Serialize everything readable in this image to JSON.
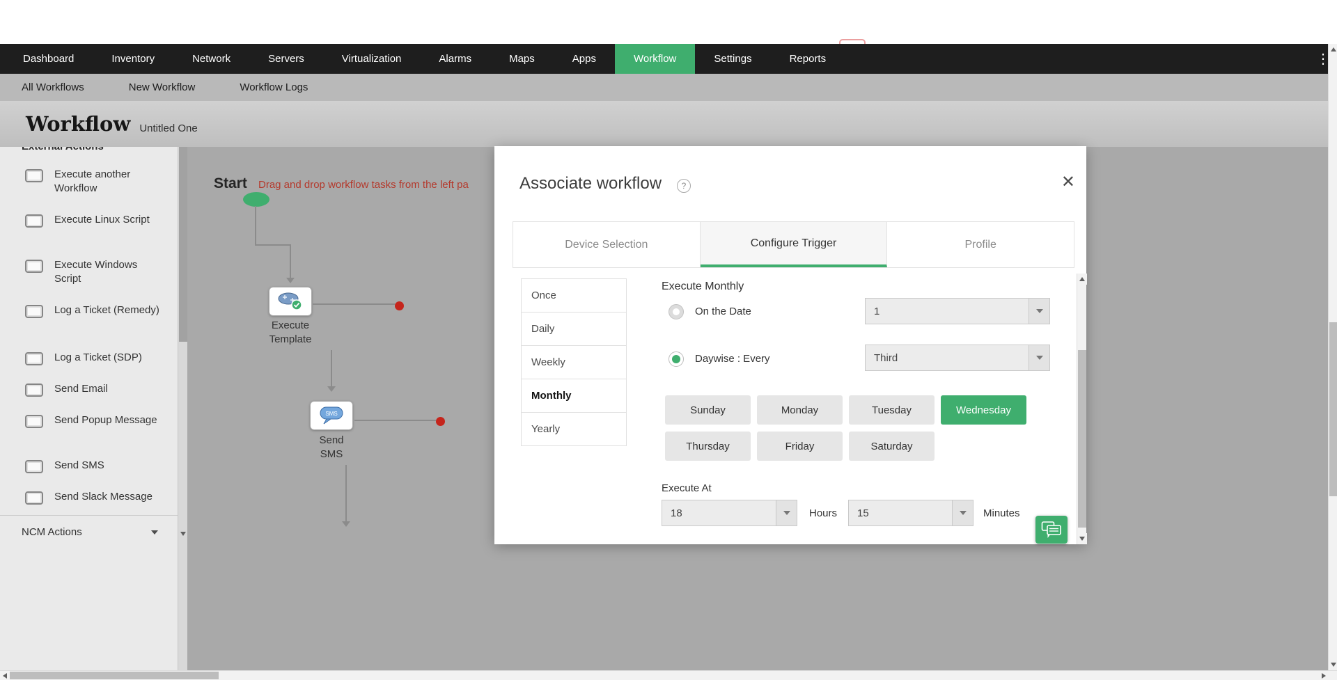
{
  "icons": {
    "kebab": "⋮",
    "help": "?",
    "close": "✕"
  },
  "nav": {
    "items": [
      "Dashboard",
      "Inventory",
      "Network",
      "Servers",
      "Virtualization",
      "Alarms",
      "Maps",
      "Apps",
      "Workflow",
      "Settings",
      "Reports"
    ],
    "active_item": "Workflow"
  },
  "subnav": {
    "items": [
      "All Workflows",
      "New Workflow",
      "Workflow Logs"
    ]
  },
  "page": {
    "title": "Workflow",
    "subtitle": "Untitled One"
  },
  "sidebar": {
    "section_header": "External Actions",
    "items": [
      "Execute another Workflow",
      "Execute Linux Script",
      "Execute Windows Script",
      "Log a Ticket (Remedy)",
      "Log a Ticket (SDP)",
      "Send Email",
      "Send Popup Message",
      "Send SMS",
      "Send Slack Message"
    ],
    "footer": "NCM Actions"
  },
  "canvas": {
    "start_label": "Start",
    "hint": "Drag and drop workflow tasks from the left pa",
    "nodes": [
      {
        "line1": "Execute",
        "line2": "Template"
      },
      {
        "line1": "Send",
        "line2": "SMS",
        "icon_text": "SMS"
      }
    ]
  },
  "modal": {
    "title": "Associate workflow",
    "tabs": [
      "Device Selection",
      "Configure Trigger",
      "Profile"
    ],
    "active_tab": "Configure Trigger",
    "schedule_tabs": [
      "Once",
      "Daily",
      "Weekly",
      "Monthly",
      "Yearly"
    ],
    "active_schedule": "Monthly",
    "heading": "Execute Monthly",
    "on_date": {
      "label": "On the Date",
      "value": "1",
      "selected": false
    },
    "daywise": {
      "label": "Daywise : Every",
      "value": "Third",
      "selected": true
    },
    "days": [
      "Sunday",
      "Monday",
      "Tuesday",
      "Wednesday",
      "Thursday",
      "Friday",
      "Saturday"
    ],
    "selected_day": "Wednesday",
    "execute_at": {
      "label": "Execute At",
      "hours": "18",
      "hours_label": "Hours",
      "minutes": "15",
      "minutes_label": "Minutes"
    }
  },
  "colors": {
    "accent_green": "#3fae6e",
    "nav_bg": "#1e1e1e",
    "canvas_bg": "#a9a9a9",
    "hint_red": "#b4392c",
    "dot_red": "#c5251c"
  }
}
